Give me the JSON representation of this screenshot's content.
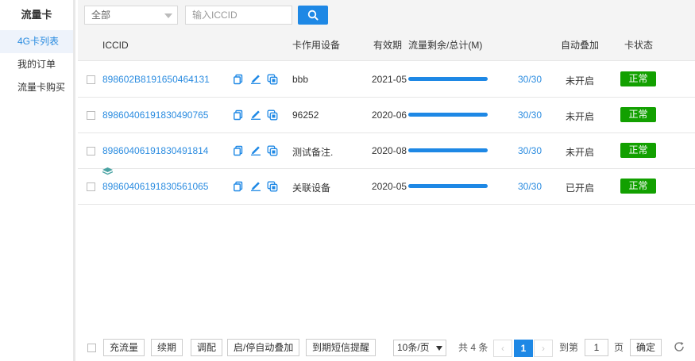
{
  "sidebar": {
    "title": "流量卡",
    "items": [
      {
        "label": "4G卡列表"
      },
      {
        "label": "我的订单"
      },
      {
        "label": "流量卡购买"
      }
    ]
  },
  "toolbar": {
    "select_value": "全部",
    "search_placeholder": "输入ICCID",
    "search_icon": "search-icon"
  },
  "table": {
    "headers": {
      "iccid": "ICCID",
      "device": "卡作用设备",
      "expiry": "有效期",
      "traffic": "流量剩余/总计(M)",
      "auto": "自动叠加",
      "status": "卡状态"
    },
    "rows": [
      {
        "iccid": "898602B8191650464131",
        "device": "bbb",
        "expiry": "2021-05",
        "remaining_fraction": 1.0,
        "ratio": "30/30",
        "auto": "未开启",
        "status": "正常",
        "stack_icon": false
      },
      {
        "iccid": "89860406191830490765",
        "device": "96252",
        "expiry": "2020-06",
        "remaining_fraction": 1.0,
        "ratio": "30/30",
        "auto": "未开启",
        "status": "正常",
        "stack_icon": false
      },
      {
        "iccid": "89860406191830491814",
        "device": "测试备注.",
        "expiry": "2020-08",
        "remaining_fraction": 1.0,
        "ratio": "30/30",
        "auto": "未开启",
        "status": "正常",
        "stack_icon": false
      },
      {
        "iccid": "89860406191830561065",
        "device": "关联设备",
        "expiry": "2020-05",
        "remaining_fraction": 1.0,
        "ratio": "30/30",
        "auto": "已开启",
        "status": "正常",
        "stack_icon": true
      }
    ]
  },
  "footer": {
    "buttons": [
      "充流量",
      "续期",
      "调配",
      "启/停自动叠加",
      "到期短信提醒"
    ],
    "page_size": "10条/页",
    "total": "共 4 条",
    "current_page": "1",
    "goto_prefix": "到第",
    "goto_value": "1",
    "goto_suffix": "页",
    "confirm": "确定"
  },
  "colors": {
    "accent": "#1e88e5",
    "link": "#2b8ce0",
    "status_ok": "#12a000"
  }
}
